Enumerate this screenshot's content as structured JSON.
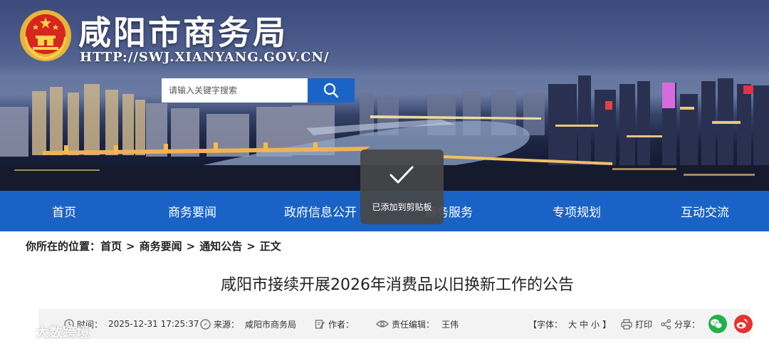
{
  "header": {
    "site_title": "咸阳市商务局",
    "site_url": "HTTP://SWJ.XIANYANG.GOV.CN/",
    "search_placeholder": "请输入关键字搜索"
  },
  "nav": {
    "items": [
      {
        "label": "首页"
      },
      {
        "label": "商务要闻"
      },
      {
        "label": "政府信息公开"
      },
      {
        "label": "商务服务"
      },
      {
        "label": "专项规划"
      },
      {
        "label": "互动交流"
      }
    ]
  },
  "toast": {
    "message": "已添加到剪贴板",
    "icon": "checkmark-icon"
  },
  "breadcrumb": {
    "prefix": "你所在的位置：",
    "items": [
      "首页",
      "商务要闻",
      "通知公告",
      "正文"
    ],
    "separator": ">"
  },
  "article": {
    "title": "咸阳市接续开展2026年消费品以旧换新工作的公告",
    "time_label": "时间：",
    "time_value": "2025-12-31 17:25:37",
    "source_label": "来源：",
    "source_value": "咸阳市商务局",
    "author_label": "作者：",
    "author_value": "",
    "editor_label": "责任编辑：",
    "editor_value": "王伟",
    "font_size_label": "【字体：",
    "font_size_options": [
      "大",
      "中",
      "小"
    ],
    "font_size_close": "】",
    "print_label": "打印",
    "share_label": "分享："
  },
  "colors": {
    "nav_bg": "#1a63c6",
    "search_btn": "#1a64c8",
    "wechat": "#22b14c",
    "weibo": "#e5332d"
  },
  "watermark": {
    "text": "大数跨境"
  }
}
